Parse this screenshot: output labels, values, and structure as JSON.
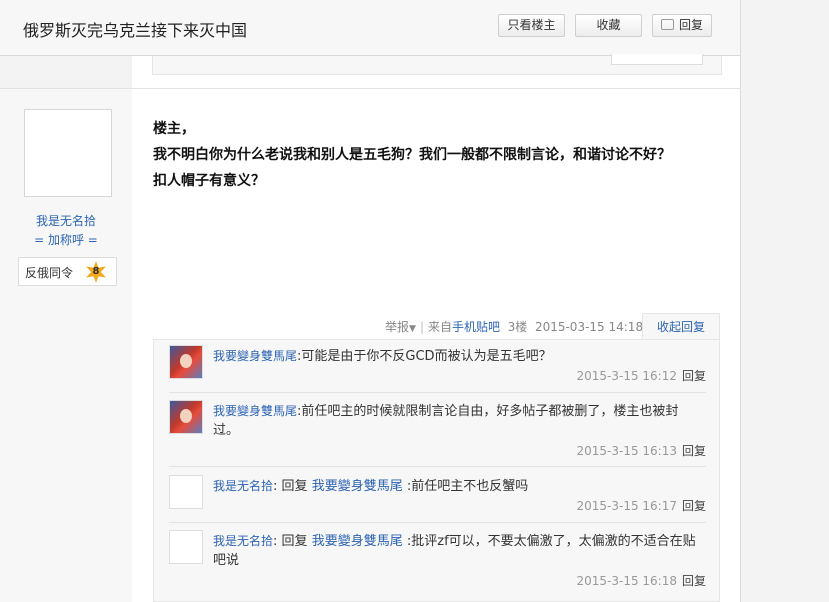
{
  "header": {
    "title": "俄罗斯灭完乌克兰接下来灭中国",
    "only_lz": "只看楼主",
    "favorite": "收藏",
    "reply": "回复"
  },
  "floor": {
    "user": {
      "name": "我是无名拾",
      "title": "= 加称呼 =",
      "badge_name": "反俄同令",
      "badge_level": "8"
    },
    "content_lines": [
      "楼主，",
      "我不明白你为什么老说我和别人是五毛狗？我们一般都不限制言论，和谐讨论不好？",
      "扣人帽子有意义？"
    ],
    "tail": {
      "report": "举报",
      "from": "来自",
      "client": "手机贴吧",
      "floor_no": "3楼",
      "time": "2015-03-15 14:18"
    },
    "collapse_label": "收起回复",
    "replies": [
      {
        "author": "我要變身雙馬尾",
        "reply_word": "",
        "target": "",
        "text": "可能是由于你不反GCD而被认为是五毛吧？",
        "time": "2015-3-15 16:12",
        "reply_label": "回复"
      },
      {
        "author": "我要變身雙馬尾",
        "reply_word": "",
        "target": "",
        "text": "前任吧主的时候就限制言论自由，好多帖子都被删了，楼主也被封过。",
        "time": "2015-3-15 16:13",
        "reply_label": "回复"
      },
      {
        "author": "我是无名拾",
        "reply_word": "回复",
        "target": "我要變身雙馬尾",
        "text": "前任吧主不也反蟹吗",
        "time": "2015-3-15 16:17",
        "reply_label": "回复"
      },
      {
        "author": "我是无名拾",
        "reply_word": "回复",
        "target": "我要變身雙馬尾",
        "text": "批评zf可以，不要太偏激了，太偏激的不适合在贴吧说",
        "time": "2015-3-15 16:18",
        "reply_label": "回复"
      }
    ]
  },
  "colors": {
    "link": "#2d64b3",
    "badge_star": "#f2a91d"
  }
}
